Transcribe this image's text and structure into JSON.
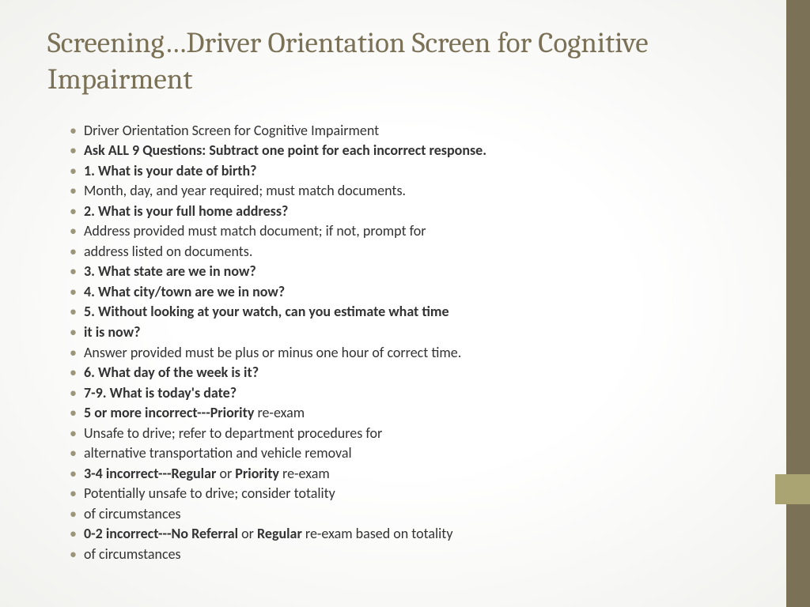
{
  "title": "Screening…Driver Orientation Screen for Cognitive Impairment",
  "bullets": [
    {
      "segments": [
        {
          "t": "Driver Orientation Screen for Cognitive Impairment",
          "b": false
        }
      ]
    },
    {
      "segments": [
        {
          "t": "Ask ALL 9 Questions: Subtract one point for each incorrect response.",
          "b": true
        }
      ]
    },
    {
      "segments": [
        {
          "t": "1. What is your date of birth?",
          "b": true
        }
      ]
    },
    {
      "segments": [
        {
          "t": "Month, day, and year required; must match documents.",
          "b": false
        }
      ]
    },
    {
      "segments": [
        {
          "t": "2. What is your full home address?",
          "b": true
        }
      ]
    },
    {
      "segments": [
        {
          "t": "Address provided must match document; if not, prompt for",
          "b": false
        }
      ]
    },
    {
      "segments": [
        {
          "t": "address listed on documents.",
          "b": false
        }
      ]
    },
    {
      "segments": [
        {
          "t": "3. What state are we in now?",
          "b": true
        }
      ]
    },
    {
      "segments": [
        {
          "t": "4. What city/town are we in now?",
          "b": true
        }
      ]
    },
    {
      "segments": [
        {
          "t": "5. Without looking at your watch, can you estimate what time",
          "b": true
        }
      ]
    },
    {
      "segments": [
        {
          "t": "it is now?",
          "b": true
        }
      ]
    },
    {
      "segments": [
        {
          "t": "Answer provided must be plus or minus one hour of correct time.",
          "b": false
        }
      ]
    },
    {
      "segments": [
        {
          "t": "6. What day of the week is it?",
          "b": true
        }
      ]
    },
    {
      "segments": [
        {
          "t": "7-9. What is today's date?",
          "b": true
        }
      ]
    },
    {
      "segments": [
        {
          "t": "5 or more incorrect---Priority ",
          "b": true
        },
        {
          "t": "re-exam",
          "b": false
        }
      ]
    },
    {
      "segments": [
        {
          "t": "Unsafe to drive; refer to department procedures for",
          "b": false
        }
      ]
    },
    {
      "segments": [
        {
          "t": "alternative transportation and vehicle removal",
          "b": false
        }
      ]
    },
    {
      "segments": [
        {
          "t": "3-4 incorrect---Regular ",
          "b": true
        },
        {
          "t": "or ",
          "b": false
        },
        {
          "t": "Priority ",
          "b": true
        },
        {
          "t": "re-exam",
          "b": false
        }
      ]
    },
    {
      "segments": [
        {
          "t": "Potentially unsafe to drive; consider totality",
          "b": false
        }
      ]
    },
    {
      "segments": [
        {
          "t": "of circumstances",
          "b": false
        }
      ]
    },
    {
      "segments": [
        {
          "t": "0-2 incorrect---No Referral ",
          "b": true
        },
        {
          "t": "or ",
          "b": false
        },
        {
          "t": "Regular ",
          "b": true
        },
        {
          "t": "re-exam based on totality",
          "b": false
        }
      ]
    },
    {
      "segments": [
        {
          "t": "of circumstances",
          "b": false
        }
      ]
    }
  ]
}
